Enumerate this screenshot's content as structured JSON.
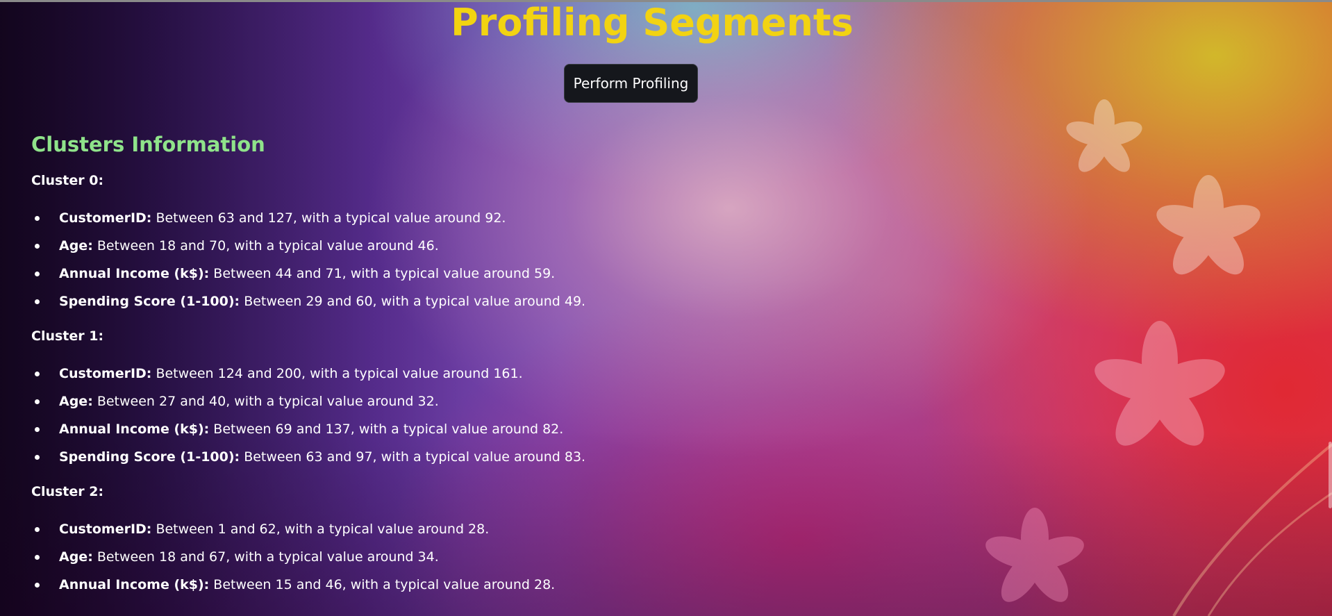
{
  "page": {
    "title": "Profiling Segments",
    "button_label": "Perform Profiling",
    "section_title": "Clusters Information",
    "title_color": "#f2d312",
    "section_color": "#8fe38a"
  },
  "clusters": [
    {
      "heading": "Cluster 0:",
      "attributes": [
        {
          "key": "CustomerID:",
          "text": " Between 63 and 127, with a typical value around 92."
        },
        {
          "key": "Age:",
          "text": " Between 18 and 70, with a typical value around 46."
        },
        {
          "key": "Annual Income (k$):",
          "text": " Between 44 and 71, with a typical value around 59."
        },
        {
          "key": "Spending Score (1-100):",
          "text": " Between 29 and 60, with a typical value around 49."
        }
      ]
    },
    {
      "heading": "Cluster 1:",
      "attributes": [
        {
          "key": "CustomerID:",
          "text": " Between 124 and 200, with a typical value around 161."
        },
        {
          "key": "Age:",
          "text": " Between 27 and 40, with a typical value around 32."
        },
        {
          "key": "Annual Income (k$):",
          "text": " Between 69 and 137, with a typical value around 82."
        },
        {
          "key": "Spending Score (1-100):",
          "text": " Between 63 and 97, with a typical value around 83."
        }
      ]
    },
    {
      "heading": "Cluster 2:",
      "attributes": [
        {
          "key": "CustomerID:",
          "text": " Between 1 and 62, with a typical value around 28."
        },
        {
          "key": "Age:",
          "text": " Between 18 and 67, with a typical value around 34."
        },
        {
          "key": "Annual Income (k$):",
          "text": " Between 15 and 46, with a typical value around 28."
        }
      ]
    }
  ]
}
